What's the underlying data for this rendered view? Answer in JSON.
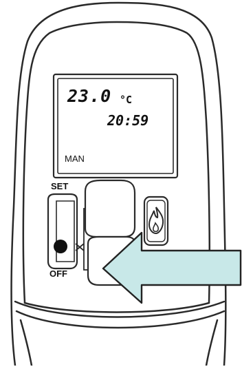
{
  "display": {
    "temperature": "23.0",
    "unit": "°C",
    "time": "20:59",
    "mode": "MAN"
  },
  "controls": {
    "set_label": "SET",
    "off_label": "OFF"
  },
  "icons": {
    "flame_button": "flame-icon",
    "annotation": "arrow-icon"
  },
  "colors": {
    "device_outline": "#2a2a2a",
    "arrow_fill": "#c8e8e8",
    "arrow_stroke": "#222222",
    "off_dot": "#111111"
  }
}
